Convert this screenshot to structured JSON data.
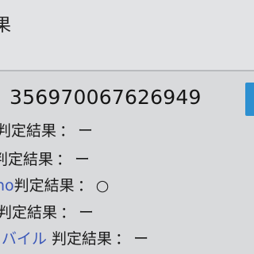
{
  "header": {
    "title_fragment": "果"
  },
  "imei": {
    "value": "356970067626949"
  },
  "results": [
    {
      "carrier": "",
      "label": "判定結果",
      "sep": "：",
      "value": "ー"
    },
    {
      "carrier": "",
      "label": "判定結果",
      "sep": "：",
      "value": "ー"
    },
    {
      "carrier": "no",
      "label": "判定結果",
      "sep": "：",
      "value": "○"
    },
    {
      "carrier": "",
      "label": "判定結果",
      "sep": "：",
      "value": "ー"
    },
    {
      "carrier": "バイル",
      "label": " 判定結果",
      "sep": "：",
      "value": "ー"
    }
  ],
  "colors": {
    "accent": "#2d8fd0",
    "carrier_text": "#3a57b8",
    "background": "#d9dadc"
  }
}
